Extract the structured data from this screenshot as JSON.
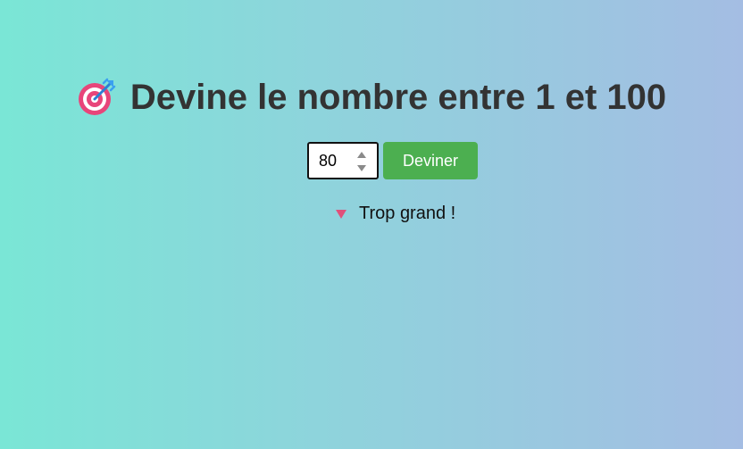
{
  "header": {
    "icon": "target-dart-icon",
    "title": "Devine le nombre entre 1 et 100"
  },
  "guess_form": {
    "input_value": "80",
    "button_label": "Deviner"
  },
  "feedback": {
    "icon": "down-triangle-icon",
    "message": "Trop grand !"
  },
  "colors": {
    "background_left": "#7ae6d6",
    "background_right": "#a4bde3",
    "title_text": "#333333",
    "button_bg": "#4caf50",
    "button_text": "#ffffff",
    "feedback_icon": "#e0507a"
  }
}
